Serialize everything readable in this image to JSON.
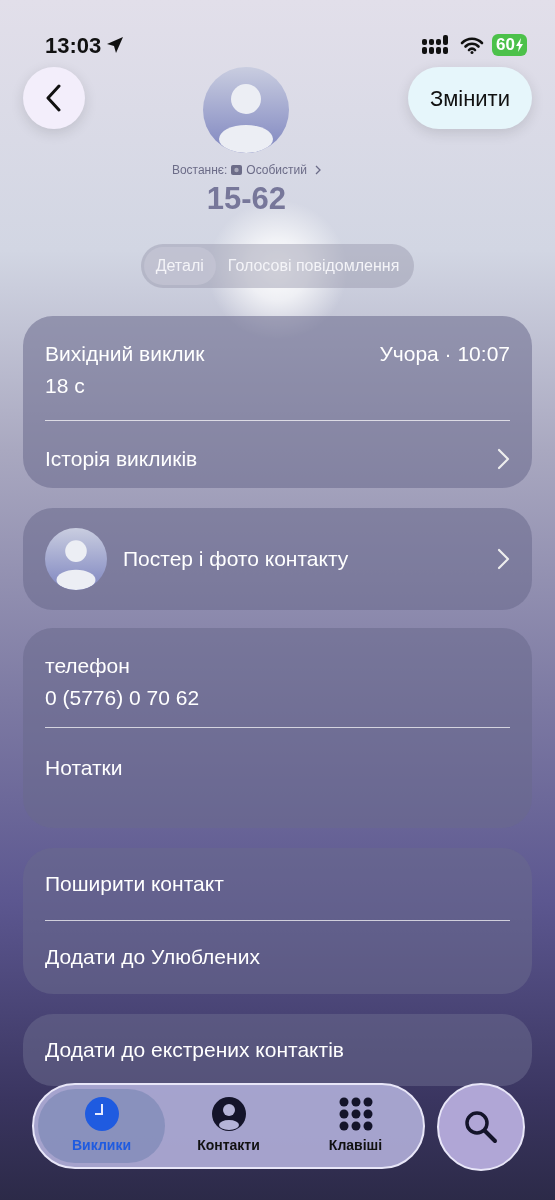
{
  "status_bar": {
    "time": "13:03",
    "battery": "60"
  },
  "header": {
    "edit_button": "Змінити",
    "last_used_label": "Востаннє:",
    "last_used_account": "Особистий",
    "title": "15-62"
  },
  "segments": [
    {
      "label": "Деталі",
      "selected": true
    },
    {
      "label": "Голосові повідомлення",
      "selected": false
    }
  ],
  "recent_call": {
    "type": "Вихідний виклик",
    "when": "Учора · 10:07",
    "duration": "18 с",
    "history": "Історія викликів"
  },
  "poster": {
    "label": "Постер і фото контакту"
  },
  "phone": {
    "label": "телефон",
    "value": "0 (5776) 0 70 62",
    "notes": "Нотатки"
  },
  "actions": [
    "Поширити контакт",
    "Додати до Улюблених"
  ],
  "emergency": "Додати до екстрених контактів",
  "tab_bar": [
    {
      "label": "Виклики",
      "selected": true
    },
    {
      "label": "Контакти",
      "selected": false
    },
    {
      "label": "Клавіші",
      "selected": false
    }
  ]
}
